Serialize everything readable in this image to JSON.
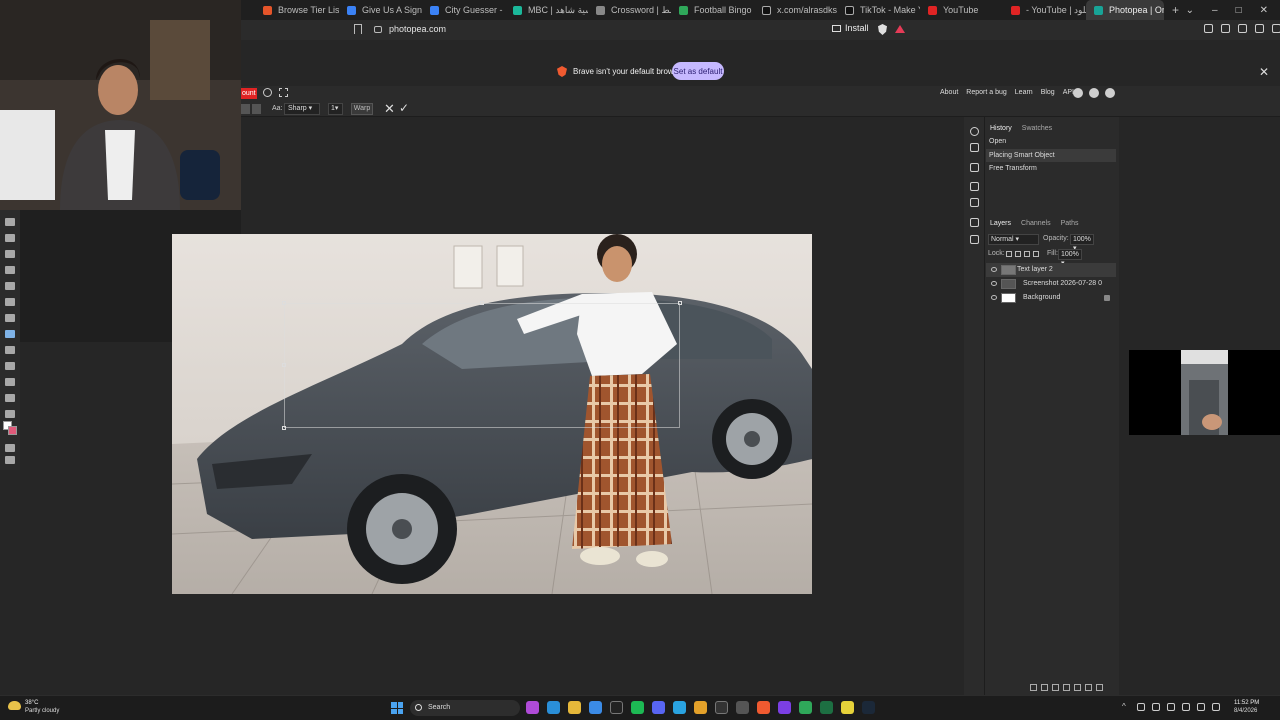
{
  "browser": {
    "tabs": [
      {
        "title": "Browse Tier List Temp",
        "color": "#e5552a"
      },
      {
        "title": "Give Us A Sign on Sto",
        "color": "#3b82f6"
      },
      {
        "title": "City Guesser - Can yo",
        "color": "#3b82f6"
      },
      {
        "title": "MBC | الرئيسية شاهد",
        "color": "#1bb89a"
      },
      {
        "title": "Crossword | الأوسط",
        "color": "#888888"
      },
      {
        "title": "Football Bingo Onlin",
        "color": "#2fa85a"
      },
      {
        "title": "x.com/alrasdksa/stat",
        "color": "#111111"
      },
      {
        "title": "TikTok - Make Your D",
        "color": "#111111"
      },
      {
        "title": "YouTube",
        "color": "#e02424"
      },
      {
        "title": "- YouTube | ابو خلود",
        "color": "#e02424"
      },
      {
        "title": "Photopea | Onlin",
        "color": "#18a497"
      }
    ],
    "window_controls": [
      "⌄",
      "–",
      "□",
      "✕"
    ],
    "url": "photopea.com",
    "install_label": "Install"
  },
  "infobar": {
    "message": "Brave isn't your default browser",
    "set_default_label": "Set as default",
    "close": "✕"
  },
  "photopea": {
    "account_label": "ount",
    "links": [
      "About",
      "Report a bug",
      "Learn",
      "Blog",
      "API"
    ],
    "social_icons": [
      "reddit-icon",
      "twitter-icon",
      "facebook-icon"
    ],
    "options": {
      "aa_label": "Aa:",
      "antialias": "Sharp",
      "size": "1",
      "warp_label": "Warp",
      "cancel": "✕",
      "commit": "✓"
    },
    "history": {
      "tabs": [
        "History",
        "Swatches"
      ],
      "items": [
        "Open",
        "Placing Smart Object",
        "Free Transform"
      ]
    },
    "layers": {
      "tabs": [
        "Layers",
        "Channels",
        "Paths"
      ],
      "blend_mode": "Normal",
      "opacity_label": "Opacity:",
      "opacity": "100%",
      "lock_label": "Lock:",
      "fill_label": "Fill:",
      "fill": "100%",
      "items": [
        "Text layer 2",
        "Screenshot 2026-07-28 0",
        "Background"
      ]
    },
    "side_icons": [
      "info-icon",
      "menu-icon",
      "brush-icon",
      "text-icon",
      "paragraph-icon",
      "css-icon",
      "image-icon"
    ]
  },
  "taskbar": {
    "weather_temp": "38°C",
    "weather_desc": "Partly cloudy",
    "search_label": "Search",
    "time": "11:52 PM",
    "date": "8/4/2026"
  },
  "colors": {
    "accent_red": "#e02424",
    "set_default_bg": "#c6b9ff",
    "selected_tool": "#7fb2e6"
  }
}
